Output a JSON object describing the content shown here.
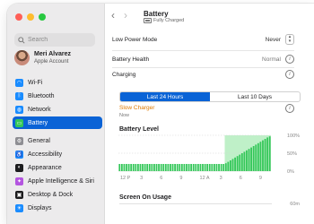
{
  "window": {
    "traffic_colors": [
      "#ff5f57",
      "#febc2e",
      "#28c840"
    ]
  },
  "sidebar": {
    "search_placeholder": "Search",
    "account": {
      "name": "Meri Alvarez",
      "subtitle": "Apple Account"
    },
    "group1": [
      {
        "label": "Wi-Fi",
        "icon": "wifi-icon",
        "color": "#1a8cff",
        "glyph": "◠"
      },
      {
        "label": "Bluetooth",
        "icon": "bluetooth-icon",
        "color": "#1a8cff",
        "glyph": "ᛒ"
      },
      {
        "label": "Network",
        "icon": "network-icon",
        "color": "#1a8cff",
        "glyph": "◍"
      },
      {
        "label": "Battery",
        "icon": "battery-icon",
        "color": "#34c759",
        "glyph": "▭",
        "active": true
      }
    ],
    "group2": [
      {
        "label": "General",
        "icon": "gear-icon",
        "color": "#8e8e93",
        "glyph": "⚙"
      },
      {
        "label": "Accessibility",
        "icon": "accessibility-icon",
        "color": "#1a8cff",
        "glyph": "♿"
      },
      {
        "label": "Appearance",
        "icon": "appearance-icon",
        "color": "#1c1c1e",
        "glyph": "◐"
      },
      {
        "label": "Apple Intelligence & Siri",
        "icon": "siri-icon",
        "color": "#b455e0",
        "glyph": "✦"
      },
      {
        "label": "Desktop & Dock",
        "icon": "dock-icon",
        "color": "#1c1c1e",
        "glyph": "▣"
      },
      {
        "label": "Displays",
        "icon": "display-icon",
        "color": "#1a8cff",
        "glyph": "☀"
      }
    ]
  },
  "header": {
    "title": "Battery",
    "subtitle": "Fully Charged"
  },
  "settings": {
    "low_power_label": "Low Power Mode",
    "low_power_value": "Never",
    "health_label": "Battery Health",
    "health_value": "Normal",
    "charging_label": "Charging"
  },
  "tabs": {
    "last24": "Last 24 Hours",
    "last10": "Last 10 Days"
  },
  "charger": {
    "status": "Slow Charger",
    "time": "Now"
  },
  "chart_data": {
    "type": "area",
    "title": "Battery Level",
    "xlabel": "",
    "ylabel": "",
    "x_ticks": [
      "12 P",
      "3",
      "6",
      "9",
      "12 A",
      "3",
      "6",
      "9"
    ],
    "y_ticks": [
      "100%",
      "50%",
      "0%"
    ],
    "ylim": [
      0,
      100
    ],
    "values": [
      20,
      20,
      20,
      20,
      20,
      20,
      20,
      20,
      20,
      20,
      20,
      20,
      20,
      20,
      20,
      20,
      20,
      20,
      20,
      20,
      20,
      20,
      20,
      20,
      20,
      20,
      20,
      20,
      20,
      20,
      20,
      20,
      20,
      20,
      20,
      20,
      20,
      20,
      20,
      20,
      20,
      20,
      20,
      20,
      20,
      20,
      22,
      26,
      30,
      34,
      38,
      42,
      46,
      50,
      54,
      58,
      62,
      66,
      70,
      74,
      78,
      82,
      86,
      90,
      94,
      97
    ],
    "charging_start_index": 46,
    "colors": {
      "bar": "#34c759",
      "charging_bg": "#bff0c8"
    }
  },
  "usage": {
    "title": "Screen On Usage",
    "tick": "60m"
  }
}
